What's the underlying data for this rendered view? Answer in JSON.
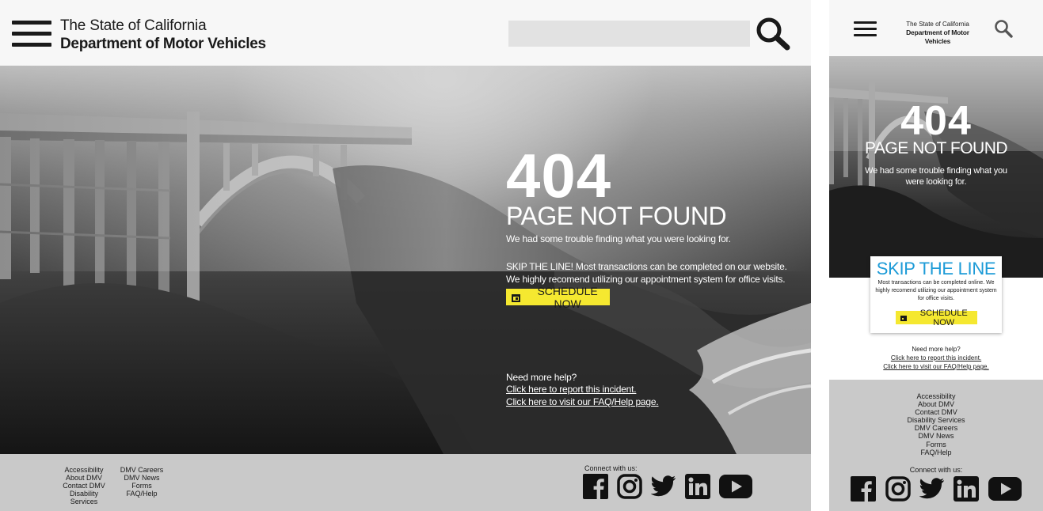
{
  "header": {
    "state_line": "The State of California",
    "dept_line": "Department of Motor Vehicles",
    "search_placeholder": ""
  },
  "error": {
    "code": "404",
    "title": "PAGE NOT FOUND",
    "message": "We had some trouble finding what you were looking for."
  },
  "desktop": {
    "skip_line_1": "SKIP THE LINE! Most transactions can be completed on our website.",
    "skip_line_2": "We highly recomend utilizing our appointment system for office visits.",
    "schedule_label": "SCHEDULE NOW",
    "help_title": "Need more help?",
    "report_link": "Click here to report this incident.",
    "faq_link": "Click here to visit our FAQ/Help page."
  },
  "mobile": {
    "skip_title": "SKIP THE LINE",
    "skip_body": "Most transactions can be completed online. We highly recomend utilizing our appointment system for office visits.",
    "schedule_label": "SCHEDULE NOW",
    "help_title": "Need more help?",
    "report_link": "Click here to report this incident.",
    "faq_link": "Click here to visit our FAQ/Help page."
  },
  "footer": {
    "col1": [
      "Accessibility",
      "About DMV",
      "Contact DMV",
      "Disability Services"
    ],
    "col2": [
      "DMV Careers",
      "DMV News",
      "Forms",
      "FAQ/Help"
    ],
    "mobile_links": [
      "Accessibility",
      "About DMV",
      "Contact DMV",
      "Disability Services",
      "DMV Careers",
      "DMV News",
      "Forms",
      "FAQ/Help"
    ],
    "connect_label": "Connect with us:",
    "social_icons": [
      "facebook-icon",
      "instagram-icon",
      "twitter-icon",
      "linkedin-icon",
      "youtube-icon"
    ]
  },
  "colors": {
    "schedule_button": "#f5e830",
    "skip_title": "#1d9bd7",
    "footer_bg": "#c9c9c9",
    "search_bg": "#e2e2e2"
  }
}
